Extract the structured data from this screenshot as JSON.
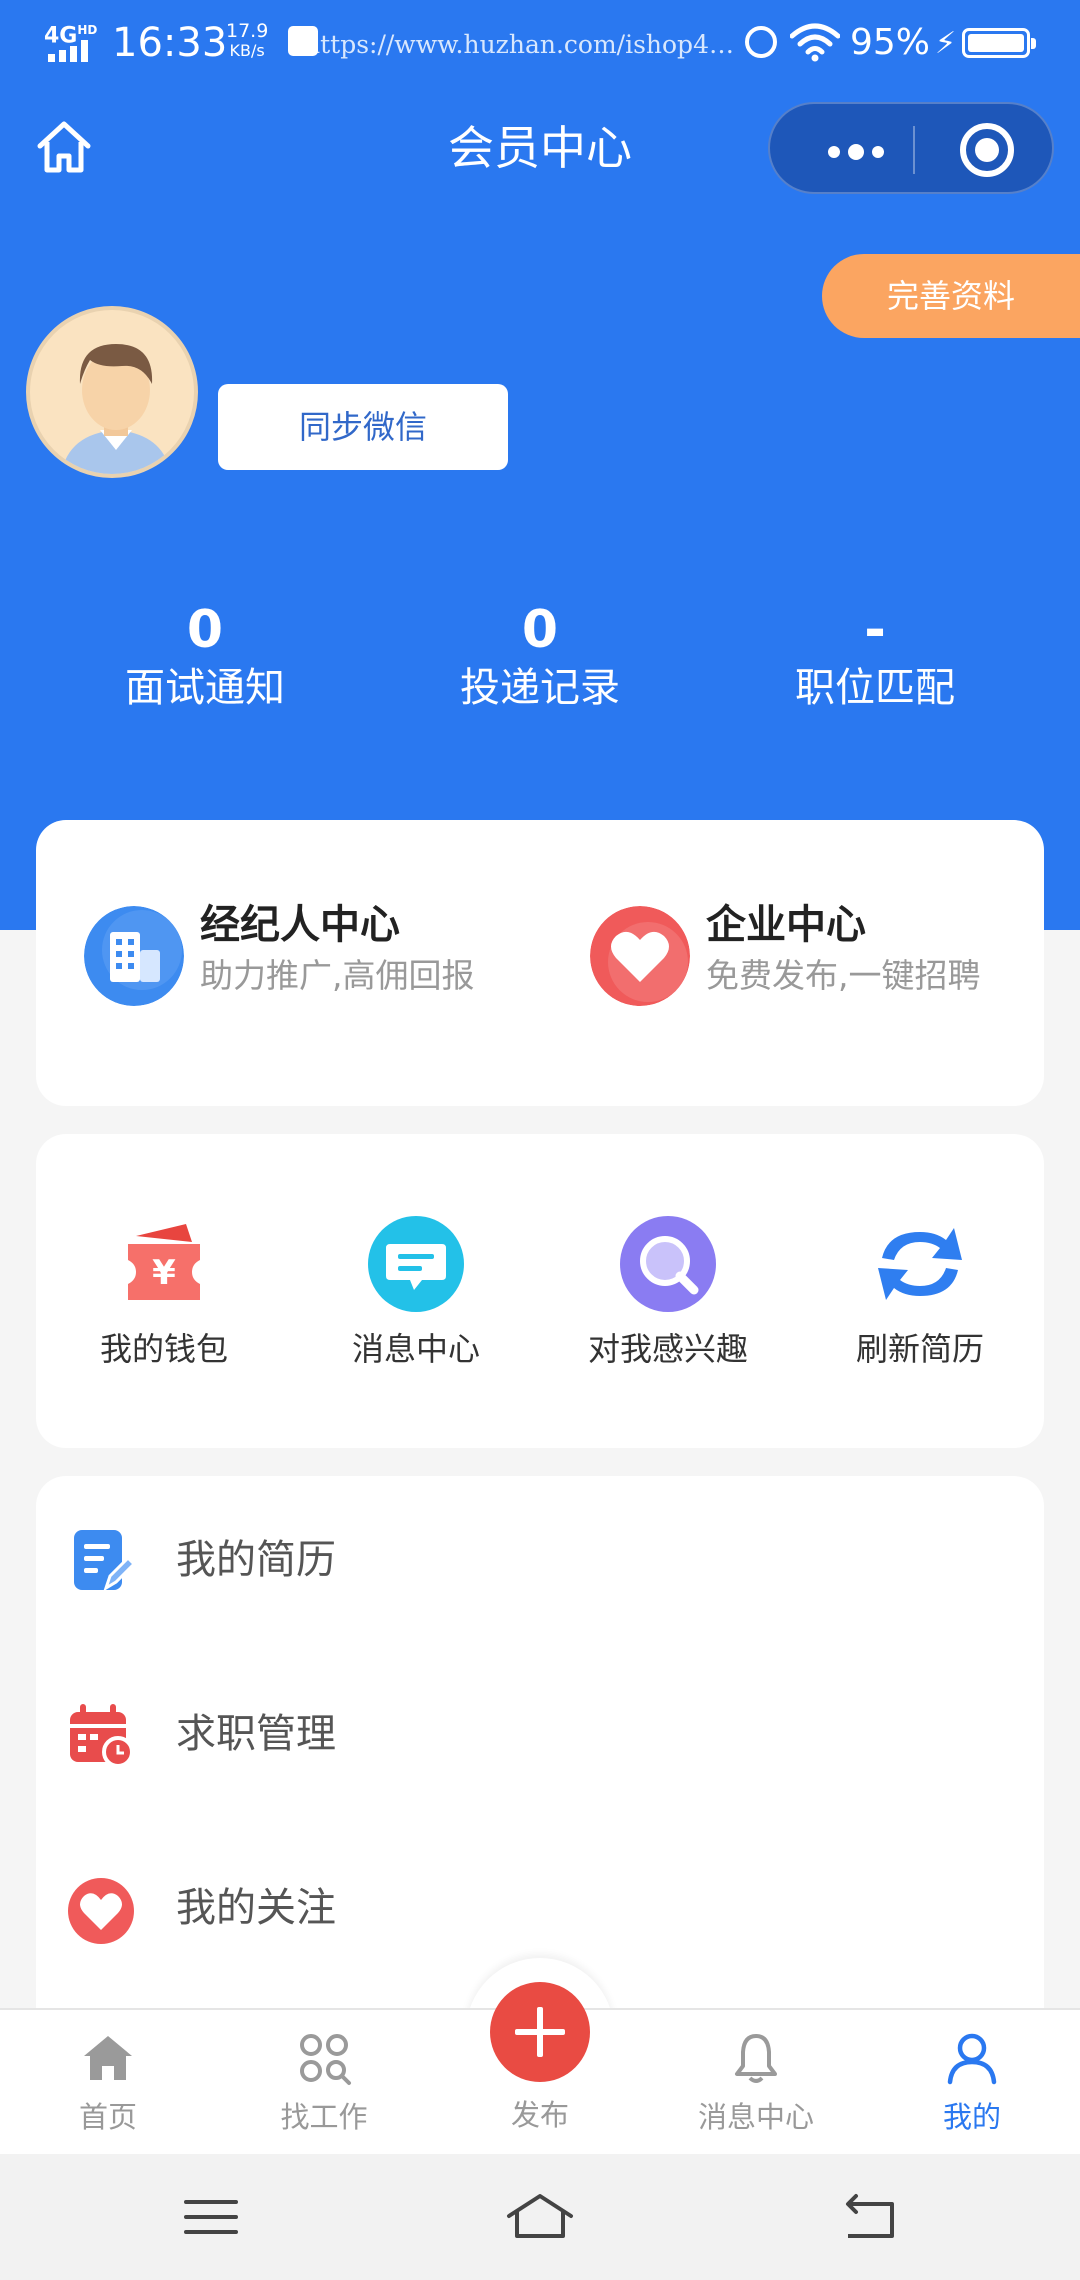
{
  "status_bar": {
    "network": "4G",
    "network_sup": "HD",
    "time": "16:33",
    "speed_value": "17.9",
    "speed_unit": "KB/s",
    "url_watermark": "https://www.huzhan.com/ishop4…",
    "battery": "95%"
  },
  "nav": {
    "title": "会员中心",
    "home_icon": "home-outline-icon",
    "more_icon": "more-dots-icon",
    "close_icon": "target-close-icon"
  },
  "profile": {
    "complete_label": "完善资料",
    "sync_label": "同步微信"
  },
  "stats": [
    {
      "value": "0",
      "label": "面试通知"
    },
    {
      "value": "0",
      "label": "投递记录"
    },
    {
      "value": "-",
      "label": "职位匹配"
    }
  ],
  "centers": [
    {
      "title": "经纪人中心",
      "subtitle": "助力推广,高佣回报",
      "icon": "building-icon",
      "color": "#3d8bf0"
    },
    {
      "title": "企业中心",
      "subtitle": "免费发布,一键招聘",
      "icon": "heart-icon",
      "color": "#f05a5a"
    }
  ],
  "shortcuts": [
    {
      "label": "我的钱包",
      "icon": "wallet-icon",
      "color": "#f2605a"
    },
    {
      "label": "消息中心",
      "icon": "message-icon",
      "color": "#29c3e6"
    },
    {
      "label": "对我感兴趣",
      "icon": "search-icon",
      "color": "#8c7cf0"
    },
    {
      "label": "刷新简历",
      "icon": "refresh-icon",
      "color": "#2f7ef0"
    }
  ],
  "menu": [
    {
      "label": "我的简历",
      "icon": "resume-edit-icon",
      "color": "#3d8bf0"
    },
    {
      "label": "求职管理",
      "icon": "calendar-icon",
      "color": "#e84c4c"
    },
    {
      "label": "我的关注",
      "icon": "heart-icon",
      "color": "#f05a5a"
    }
  ],
  "tabbar": {
    "tabs": [
      {
        "label": "首页",
        "icon": "home-filled-icon"
      },
      {
        "label": "找工作",
        "icon": "grid-search-icon"
      },
      {
        "label": "消息中心",
        "icon": "bell-icon"
      },
      {
        "label": "我的",
        "icon": "user-icon"
      }
    ],
    "publish_label": "发布",
    "active_color": "#2a78f0"
  },
  "colors": {
    "brand_blue": "#2a78f0",
    "accent_orange": "#fba561",
    "publish_red": "#e94b43"
  }
}
